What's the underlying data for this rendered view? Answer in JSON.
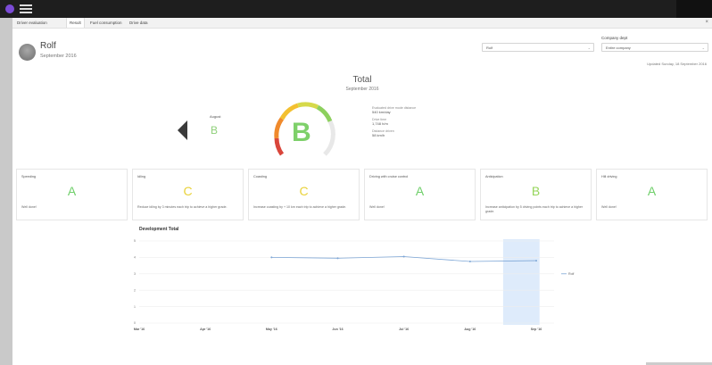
{
  "tabs": [
    {
      "label": "Driver evaluation",
      "active": false
    },
    {
      "label": "Result",
      "active": true
    },
    {
      "label": "Fuel consumption",
      "active": false
    },
    {
      "label": "Drive data",
      "active": false
    }
  ],
  "close_label": "×",
  "user": {
    "name": "Rolf",
    "period": "September 2016"
  },
  "filters": {
    "driver_select": "Rolf",
    "company_dept_label": "Company dept",
    "company_dept_select": "Entire company",
    "updated": "Updated Sunday, 18 September 2016"
  },
  "total": {
    "title": "Total",
    "date": "September 2016",
    "grade": "B",
    "grade_color": "#7ed06a",
    "prev_label": "August",
    "prev_grade": "B",
    "stats": [
      {
        "label": "Evaluated drive mode distance",
        "value": "540 km/day"
      },
      {
        "label": "Drive time",
        "value": "1,748 h/m"
      },
      {
        "label": "Distance driven",
        "value": "58 km/h"
      }
    ]
  },
  "cards": [
    {
      "title": "Speeding",
      "grade": "A",
      "color": "#6fcf6a",
      "desc": "Well done!"
    },
    {
      "title": "Idling",
      "grade": "C",
      "color": "#e9d23a",
      "desc": "Reduce idling by 3 minutes each trip to achieve a higher grade."
    },
    {
      "title": "Coasting",
      "grade": "C",
      "color": "#e9d23a",
      "desc": "Increase coasting by + 10 km each trip to achieve a higher grade."
    },
    {
      "title": "Driving with cruise control",
      "grade": "A",
      "color": "#6fcf6a",
      "desc": "Well done!"
    },
    {
      "title": "Anticipation",
      "grade": "B",
      "color": "#95d55a",
      "desc": "Increase anticipation by 5 driving points each trip to achieve a higher grade."
    },
    {
      "title": "Hill driving",
      "grade": "A",
      "color": "#6fcf6a",
      "desc": "Well done!"
    }
  ],
  "development_title": "Development Total",
  "chart_data": {
    "type": "line",
    "categories": [
      "Mar '16",
      "Apr '16",
      "May '16",
      "Jun '16",
      "Jul '16",
      "Aug '16",
      "Sep '16"
    ],
    "series": [
      {
        "name": "Rolf",
        "values": [
          null,
          null,
          4.0,
          3.95,
          4.05,
          3.75,
          3.8
        ],
        "color": "#7da6d6"
      }
    ],
    "yticks": [
      0,
      1,
      2,
      3,
      4,
      5
    ],
    "ylim": [
      0,
      5
    ],
    "highlight_category": "Sep '16",
    "grid": true,
    "legend": "right"
  }
}
